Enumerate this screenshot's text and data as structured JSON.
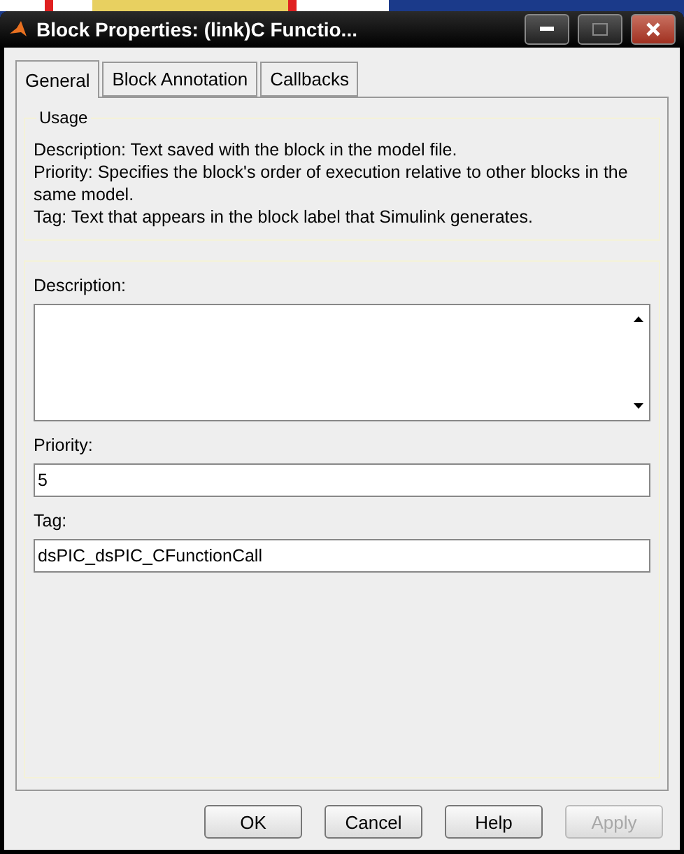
{
  "window": {
    "title": "Block Properties: (link)C Functio..."
  },
  "tabs": [
    {
      "label": "General",
      "selected": true
    },
    {
      "label": "Block Annotation",
      "selected": false
    },
    {
      "label": "Callbacks",
      "selected": false
    }
  ],
  "usage": {
    "title": "Usage",
    "lines": [
      "Description: Text saved with the block in the model file.",
      "Priority: Specifies the block's order of execution relative to other blocks in the same model.",
      "Tag: Text that appears in the block label that Simulink generates."
    ]
  },
  "fields": [
    {
      "kind": "textarea",
      "label": "Description:"
    },
    {
      "kind": "input",
      "label": "Priority:",
      "value": "5"
    },
    {
      "kind": "input",
      "label": "Tag:",
      "value": "dsPIC_dsPIC_CFunctionCall"
    }
  ],
  "buttons": [
    {
      "label": "OK",
      "disabled": false
    },
    {
      "label": "Cancel",
      "disabled": false
    },
    {
      "label": "Help",
      "disabled": false
    },
    {
      "label": "Apply",
      "disabled": true
    }
  ]
}
